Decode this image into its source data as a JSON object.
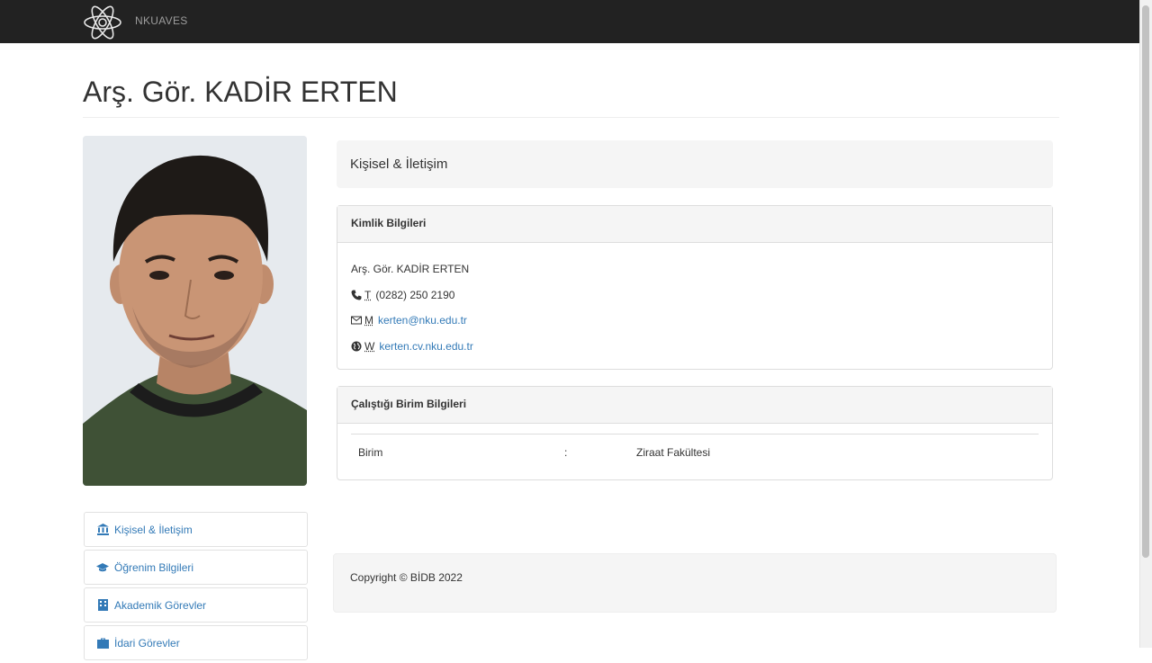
{
  "navbar": {
    "brand_text": "NKUAVES",
    "logo_icon": "atom-flower-logo"
  },
  "page": {
    "title": "Arş. Gör. KADİR ERTEN"
  },
  "side_menu": {
    "items": [
      {
        "label": "Kişisel & İletişim",
        "icon": "bank-icon"
      },
      {
        "label": "Öğrenim Bilgileri",
        "icon": "graduation-cap-icon"
      },
      {
        "label": "Akademik Görevler",
        "icon": "building-icon"
      },
      {
        "label": "İdari Görevler",
        "icon": "briefcase-icon"
      }
    ]
  },
  "main": {
    "section_title": "Kişisel & İletişim",
    "identity": {
      "heading": "Kimlik Bilgileri",
      "name": "Arş. Gör. KADİR ERTEN",
      "phone_abbr": "T",
      "phone": "(0282) 250 2190",
      "mail_abbr": "M",
      "email": "kerten@nku.edu.tr",
      "web_abbr": "W",
      "website": "kerten.cv.nku.edu.tr"
    },
    "unit": {
      "heading": "Çalıştığı Birim Bilgileri",
      "label": "Birim",
      "separator": ":",
      "value": "Ziraat Fakültesi"
    }
  },
  "footer": {
    "copyright": "Copyright © BİDB 2022"
  },
  "colors": {
    "navbar": "#222222",
    "link": "#337ab7",
    "panel_heading": "#f5f5f5"
  }
}
